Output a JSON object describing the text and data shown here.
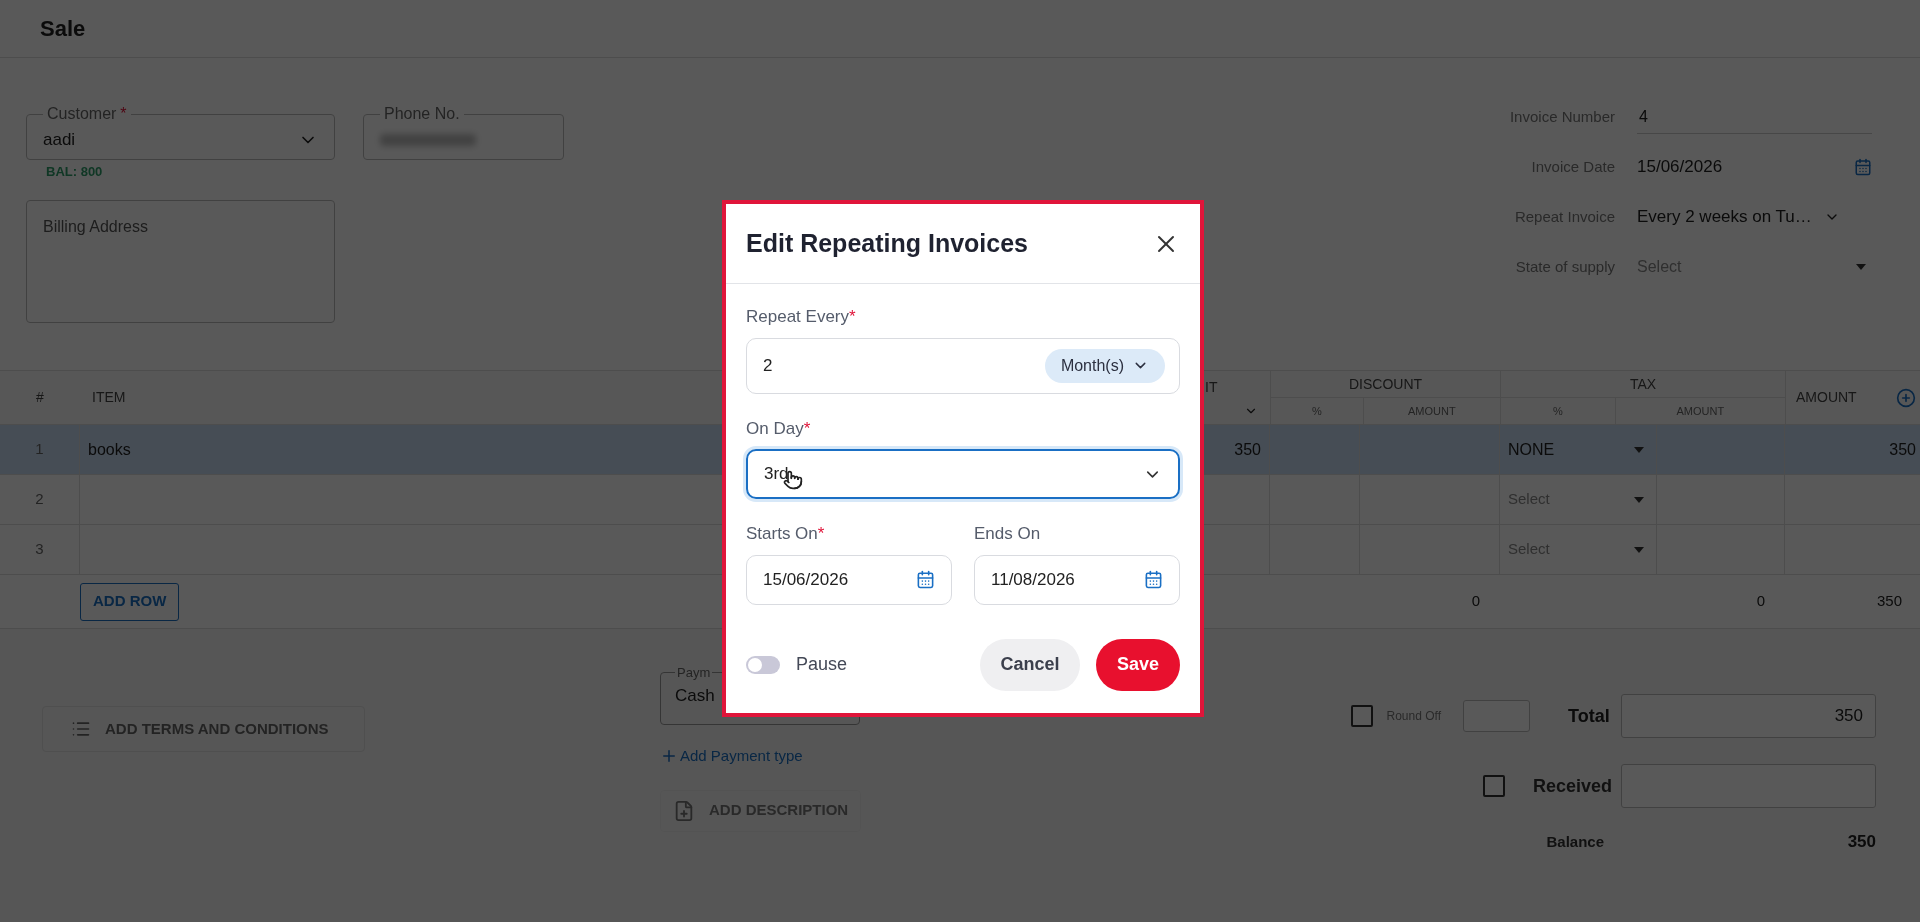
{
  "page": {
    "title": "Sale"
  },
  "customer": {
    "label": "Customer",
    "required_mark": "*",
    "value": "aadi",
    "balance": "BAL: 800"
  },
  "phone": {
    "label": "Phone No."
  },
  "billing_address": {
    "placeholder": "Billing Address"
  },
  "invoice_fields": [
    {
      "kind": "text",
      "label": "Invoice Number",
      "value": "4"
    },
    {
      "kind": "date",
      "label": "Invoice Date",
      "value": "15/06/2026"
    },
    {
      "kind": "dropdown",
      "label": "Repeat Invoice",
      "value": "Every 2 weeks on Tu…"
    },
    {
      "kind": "select",
      "label": "State of supply",
      "placeholder": "Select"
    }
  ],
  "table": {
    "columns": [
      {
        "kind": "plain",
        "label": "#"
      },
      {
        "kind": "plain",
        "label": "ITEM"
      },
      {
        "kind": "dropdown",
        "label": "IT"
      },
      {
        "kind": "group",
        "label": "DISCOUNT",
        "subcolumns": [
          "%",
          "AMOUNT"
        ]
      },
      {
        "kind": "group",
        "label": "TAX",
        "subcolumns": [
          "%",
          "AMOUNT"
        ]
      },
      {
        "kind": "plain",
        "label": "AMOUNT"
      }
    ],
    "rows": [
      {
        "number": "1",
        "item": "books",
        "column_3": "350",
        "tax": "NONE",
        "amount": "350",
        "selected": true
      },
      {
        "number": "2",
        "tax_placeholder": "Select",
        "selected": false
      },
      {
        "number": "3",
        "tax_placeholder": "Select",
        "selected": false
      }
    ],
    "add_row_button": "ADD ROW",
    "totals": {
      "discount_amount": "0",
      "tax_amount": "0",
      "amount": "350"
    }
  },
  "terms_button": "ADD TERMS AND CONDITIONS",
  "payment": {
    "label": "Paym",
    "value": "Cash"
  },
  "add_payment_link": "Add Payment type",
  "description_button": "ADD DESCRIPTION",
  "round_off": {
    "label": "Round Off",
    "checked": false
  },
  "total": {
    "label": "Total",
    "value": "350"
  },
  "received": {
    "label": "Received",
    "checked": false
  },
  "balance": {
    "label": "Balance",
    "value": "350"
  },
  "dialog": {
    "title": "Edit Repeating Invoices",
    "repeat_every": {
      "label": "Repeat Every",
      "required_mark": "*",
      "value": "2",
      "unit": "Month(s)"
    },
    "on_day": {
      "label": "On Day",
      "required_mark": "*",
      "value": "3rd",
      "focused": true
    },
    "starts_on": {
      "label": "Starts On",
      "required_mark": "*",
      "value": "15/06/2026"
    },
    "ends_on": {
      "label": "Ends On",
      "value": "11/08/2026"
    },
    "pause": {
      "label": "Pause",
      "on": false
    },
    "buttons": [
      {
        "kind": "cancel",
        "label": "Cancel"
      },
      {
        "kind": "save",
        "label": "Save"
      }
    ]
  }
}
